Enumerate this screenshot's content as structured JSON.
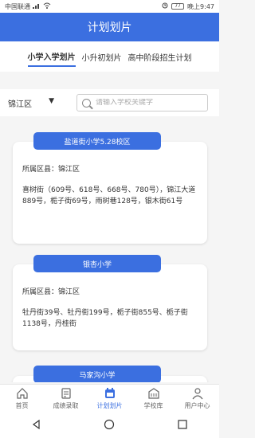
{
  "status_bar": {
    "carrier": "中国联通",
    "time": "晚上9:47",
    "battery": "77"
  },
  "header": {
    "title": "计划划片"
  },
  "tabs": [
    {
      "label": "小学入学划片",
      "active": true
    },
    {
      "label": "小升初划片",
      "active": false
    },
    {
      "label": "高中阶段招生计划",
      "active": false
    }
  ],
  "filter": {
    "district": "锦江区",
    "search_placeholder": "请输入学校关键字"
  },
  "cards": [
    {
      "name": "盐道街小学5.28校区",
      "district_line": "所属区县：锦江区",
      "area": "喜树街（609号、618号、668号、780号），锦江大道889号，栀子街69号，雨树巷128号，银木街61号"
    },
    {
      "name": "银杏小学",
      "district_line": "所属区县：锦江区",
      "area": "牡丹街39号、牡丹街199号，栀子街855号、栀子街1138号，丹桂街"
    },
    {
      "name": "马家沟小学"
    }
  ],
  "bottom_nav": [
    {
      "label": "首页",
      "icon": "home-icon"
    },
    {
      "label": "成绩录取",
      "icon": "document-icon"
    },
    {
      "label": "计划划片",
      "icon": "calendar-icon",
      "active": true
    },
    {
      "label": "学校库",
      "icon": "building-icon"
    },
    {
      "label": "用户中心",
      "icon": "user-icon"
    }
  ],
  "colors": {
    "accent": "#3b6fe0"
  }
}
